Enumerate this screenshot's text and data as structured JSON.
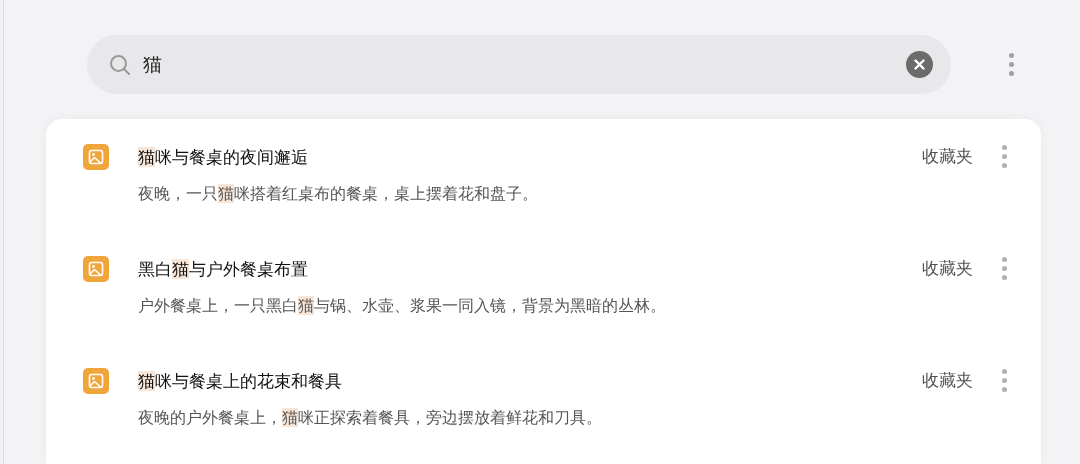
{
  "search": {
    "value": "猫"
  },
  "results": [
    {
      "title": [
        {
          "text": "猫",
          "highlight": true
        },
        {
          "text": "咪与餐桌的夜间邂逅",
          "highlight": false
        }
      ],
      "description": [
        {
          "text": "夜晚，一只",
          "highlight": false
        },
        {
          "text": "猫",
          "highlight": true
        },
        {
          "text": "咪搭着红桌布的餐桌，桌上摆着花和盘子。",
          "highlight": false
        }
      ],
      "folder": "收藏夹"
    },
    {
      "title": [
        {
          "text": "黑白",
          "highlight": false
        },
        {
          "text": "猫",
          "highlight": true
        },
        {
          "text": "与户外餐桌布置",
          "highlight": false
        }
      ],
      "description": [
        {
          "text": "户外餐桌上，一只黑白",
          "highlight": false
        },
        {
          "text": "猫",
          "highlight": true
        },
        {
          "text": "与锅、水壶、浆果一同入镜，背景为黑暗的丛林。",
          "highlight": false
        }
      ],
      "folder": "收藏夹"
    },
    {
      "title": [
        {
          "text": "猫",
          "highlight": true
        },
        {
          "text": "咪与餐桌上的花束和餐具",
          "highlight": false
        }
      ],
      "description": [
        {
          "text": "夜晚的户外餐桌上，",
          "highlight": false
        },
        {
          "text": "猫",
          "highlight": true
        },
        {
          "text": "咪正探索着餐具，旁边摆放着鲜花和刀具。",
          "highlight": false
        }
      ],
      "folder": "收藏夹"
    }
  ]
}
